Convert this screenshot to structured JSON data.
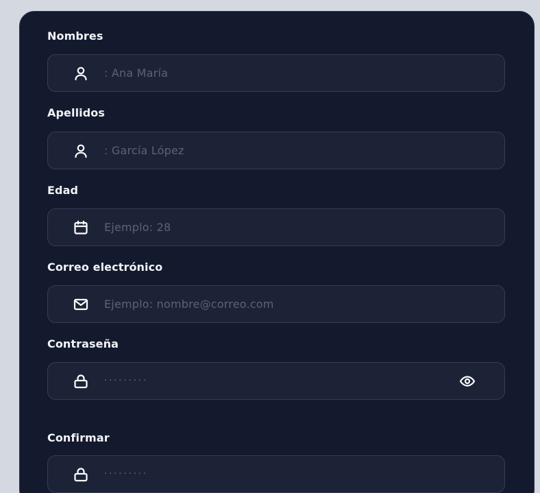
{
  "form": {
    "nombres": {
      "label": "Nombres",
      "value": ": Ana María",
      "icon": "user-icon"
    },
    "apellidos": {
      "label": "Apellidos",
      "value": ": García López",
      "icon": "user-icon"
    },
    "edad": {
      "label": "Edad",
      "placeholder": "Ejemplo: 28",
      "icon": "calendar-icon"
    },
    "correo": {
      "label": "Correo electrónico",
      "placeholder": "Ejemplo: nombre@correo.com",
      "icon": "mail-icon"
    },
    "contrasena": {
      "label": "Contraseña",
      "value": "·········",
      "icon": "lock-icon",
      "toggle_icon": "eye-icon"
    },
    "confirmar": {
      "label": "Confirmar",
      "value": "·········",
      "icon": "lock-icon"
    }
  },
  "colors": {
    "card_bg": "#141a2e",
    "field_bg": "#1d2337",
    "field_border": "#363c52",
    "label": "#f2f3f7",
    "placeholder": "#5d6274",
    "icon": "#ffffff",
    "page_bg": "#d4d8e0"
  }
}
